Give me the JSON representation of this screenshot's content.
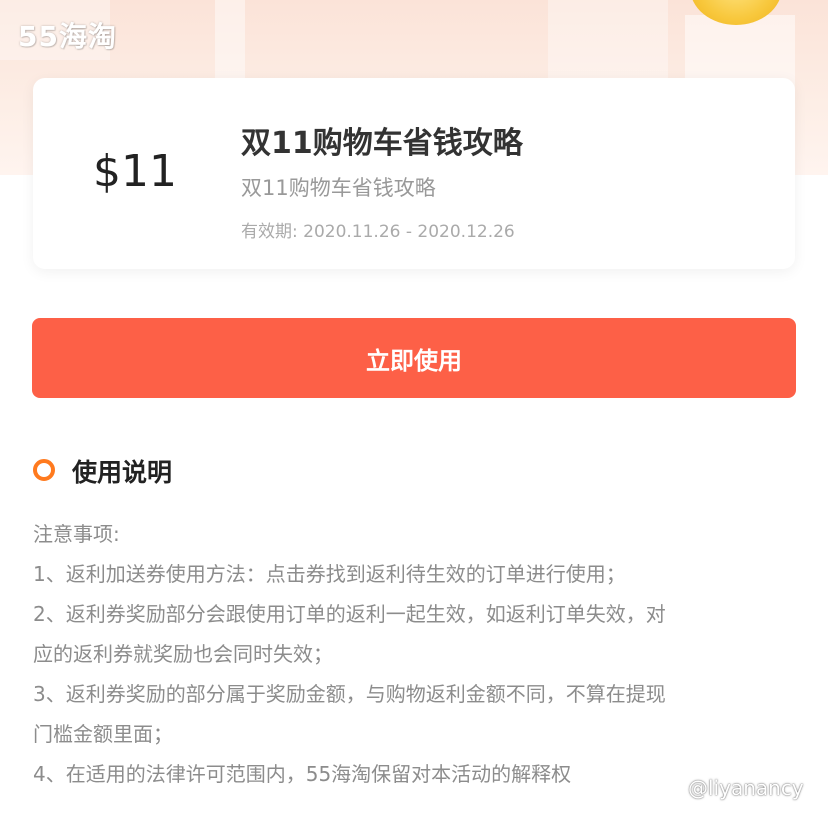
{
  "header": {
    "logo_text": "55海淘"
  },
  "coupon": {
    "amount": "$11",
    "title": "双11购物车省钱攻略",
    "subtitle": "双11购物车省钱攻略",
    "validity": "有效期: 2020.11.26 - 2020.12.26"
  },
  "action": {
    "use_label": "立即使用"
  },
  "instructions": {
    "heading": "使用说明",
    "lines": [
      "注意事项:",
      "1、返利加送券使用方法：点击券找到返利待生效的订单进行使用；",
      "2、返利券奖励部分会跟使用订单的返利一起生效，如返利订单失效，对",
      "应的返利券就奖励也会同时失效；",
      "3、返利券奖励的部分属于奖励金额，与购物返利金额不同，不算在提现",
      "门槛金额里面；",
      "4、在适用的法律许可范围内，55海淘保留对本活动的解释权"
    ]
  },
  "watermark": "@liyanancy",
  "colors": {
    "button": "#fd6047",
    "section_dot": "#ff7a1e",
    "header_bg": "#fbe3d8"
  },
  "icons": {
    "section_marker": "ring-dot-icon"
  }
}
